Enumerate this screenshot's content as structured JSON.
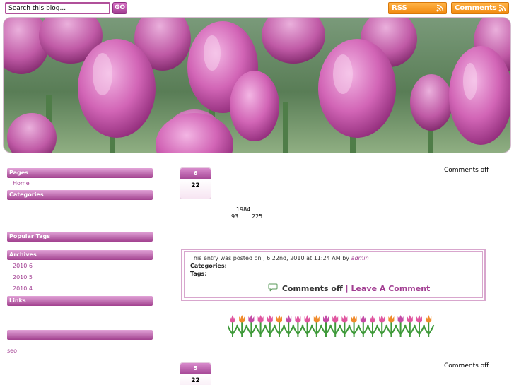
{
  "topbar": {
    "search_value": "Search this blog...",
    "go_label": "GO",
    "rss_label": "RSS",
    "comments_label": "Comments"
  },
  "sidebar": {
    "pages_heading": "Pages",
    "pages_items": [
      "Home"
    ],
    "categories_heading": "Categories",
    "popular_tags_heading": "Popular Tags",
    "archives_heading": "Archives",
    "archives_items": [
      "2010 6",
      "2010 5",
      "2010 4"
    ],
    "links_heading": "Links",
    "seo_link": "seo"
  },
  "posts": [
    {
      "month": "6",
      "day": "22",
      "comments_status": "Comments off",
      "body_line1": "1984",
      "body_line2_a": "93",
      "body_line2_b": "225"
    },
    {
      "month": "5",
      "day": "22",
      "comments_status": "Comments off"
    }
  ],
  "entry_meta": {
    "posted_prefix": "This entry was posted on",
    "posted_date": ", 6  22nd, 2010 at 11:24 AM by",
    "author": "admin",
    "categories_label": "Categories:",
    "tags_label": "Tags:",
    "comments_off": "Comments off",
    "separator": "|",
    "leave_comment": "Leave A Comment"
  },
  "colors": {
    "accent": "#a23e92",
    "feed_orange": "#f28a0f",
    "meta_border": "#d8a6cd"
  },
  "icons": [
    "rss-icon",
    "comment-bubble-icon"
  ]
}
